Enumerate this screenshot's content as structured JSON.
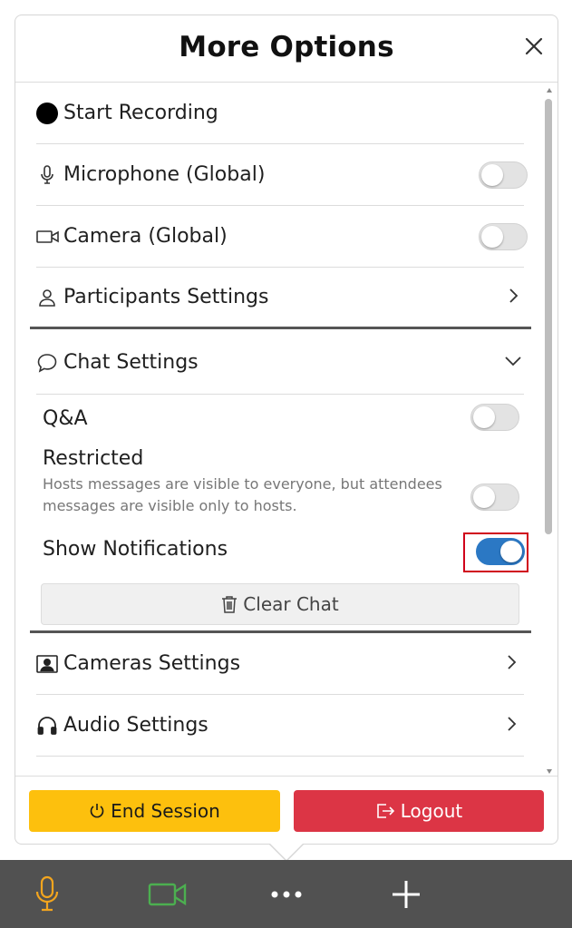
{
  "panel": {
    "title": "More Options"
  },
  "menu": {
    "start_recording": "Start Recording",
    "microphone": "Microphone (Global)",
    "microphone_on": false,
    "camera": "Camera (Global)",
    "camera_on": false,
    "participants": "Participants Settings",
    "chat": "Chat Settings",
    "cameras_settings": "Cameras Settings",
    "audio_settings": "Audio Settings"
  },
  "chat_settings": {
    "qa_label": "Q&A",
    "qa_on": false,
    "restricted_label": "Restricted",
    "restricted_desc": "Hosts messages are visible to everyone, but attendees messages are visible only to hosts.",
    "restricted_on": false,
    "notifications_label": "Show Notifications",
    "notifications_on": true,
    "clear_chat": "Clear Chat"
  },
  "footer": {
    "end_session": "End Session",
    "logout": "Logout"
  },
  "colors": {
    "end_session_bg": "#fdc00d",
    "logout_bg": "#dc3545",
    "toggle_on": "#2b78c4",
    "mic_icon": "#f3a51e",
    "camera_icon": "#4caf50",
    "bottom_bar": "#515151"
  },
  "bottom_bar": {
    "icons": [
      "microphone-icon",
      "video-camera-icon",
      "more-dots-icon",
      "plus-icon"
    ]
  }
}
